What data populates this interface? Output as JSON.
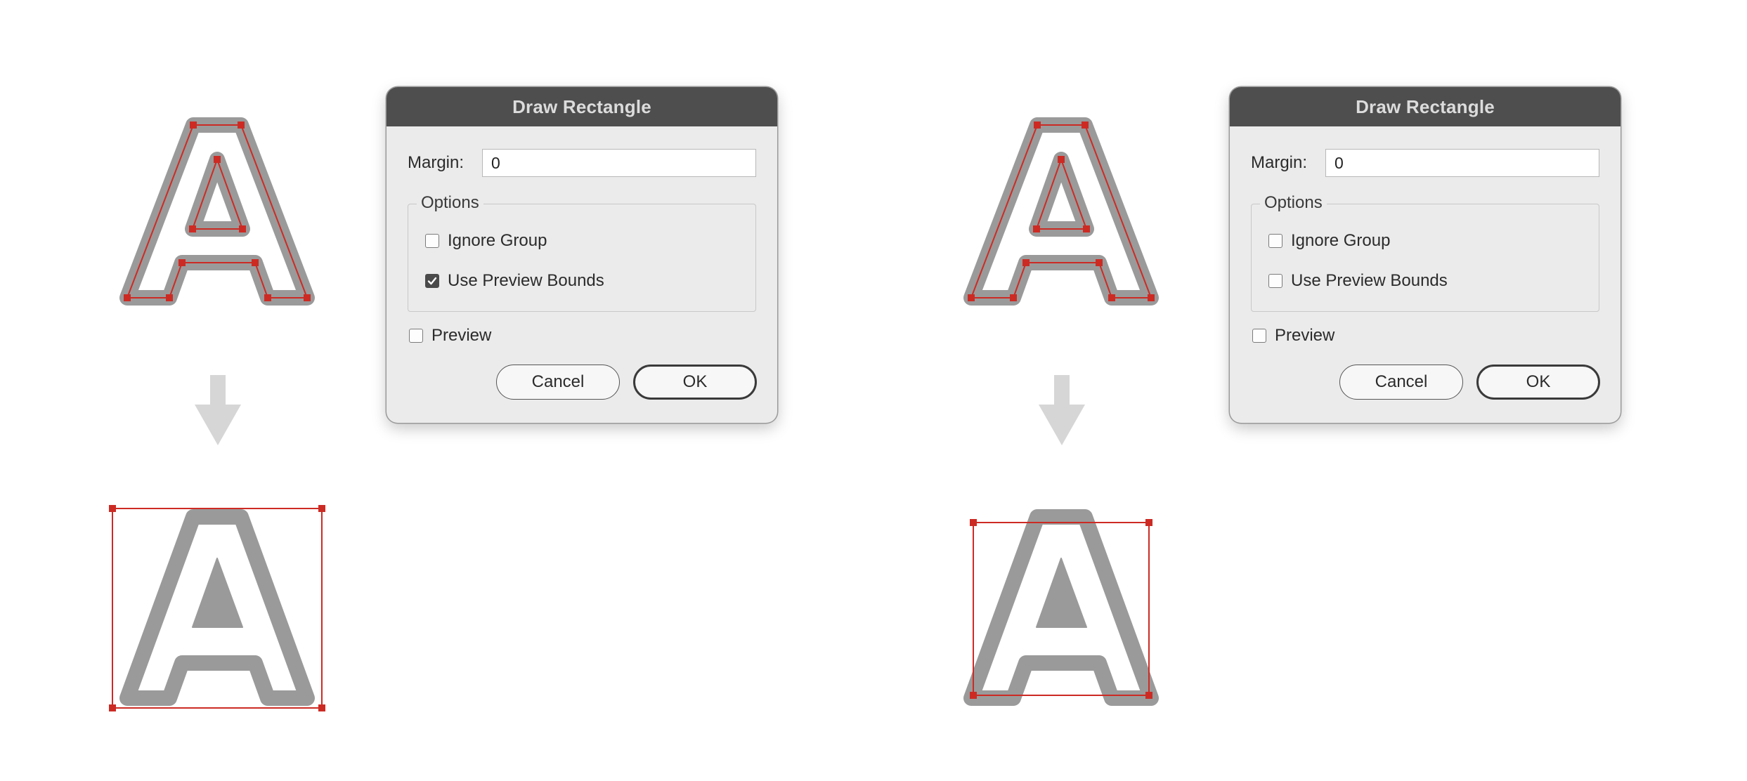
{
  "colors": {
    "letter_stroke": "#9a9a9a",
    "letter_fill": "#ffffff",
    "selection": "#cc2b24",
    "arrow": "#d6d6d6",
    "titlebar": "#4f4e4e"
  },
  "dialogs": [
    {
      "title": "Draw Rectangle",
      "margin_label": "Margin:",
      "margin_value": "0",
      "options_legend": "Options",
      "ignore_group_label": "Ignore Group",
      "ignore_group_checked": false,
      "use_preview_bounds_label": "Use Preview Bounds",
      "use_preview_bounds_checked": true,
      "preview_label": "Preview",
      "preview_checked": false,
      "cancel_label": "Cancel",
      "ok_label": "OK"
    },
    {
      "title": "Draw Rectangle",
      "margin_label": "Margin:",
      "margin_value": "0",
      "options_legend": "Options",
      "ignore_group_label": "Ignore Group",
      "ignore_group_checked": false,
      "use_preview_bounds_label": "Use Preview Bounds",
      "use_preview_bounds_checked": false,
      "preview_label": "Preview",
      "preview_checked": false,
      "cancel_label": "Cancel",
      "ok_label": "OK"
    }
  ]
}
